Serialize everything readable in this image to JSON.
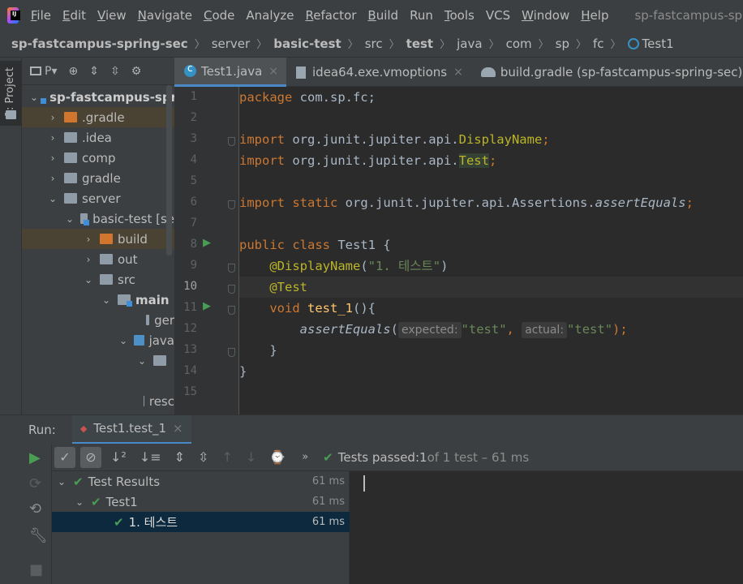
{
  "menu": {
    "items": [
      {
        "label": "File",
        "u": "F",
        "rest": "ile"
      },
      {
        "label": "Edit",
        "u": "E",
        "rest": "dit"
      },
      {
        "label": "View",
        "u": "V",
        "rest": "iew"
      },
      {
        "label": "Navigate",
        "u": "N",
        "rest": "avigate"
      },
      {
        "label": "Code",
        "u": "C",
        "rest": "ode"
      },
      {
        "label": "Analyze",
        "u": "",
        "rest": "Analyze"
      },
      {
        "label": "Refactor",
        "u": "R",
        "rest": "efactor"
      },
      {
        "label": "Build",
        "u": "B",
        "rest": "uild"
      },
      {
        "label": "Run",
        "u": "",
        "rest": "Run"
      },
      {
        "label": "Tools",
        "u": "T",
        "rest": "ools"
      },
      {
        "label": "VCS",
        "u": "",
        "rest": "VCS"
      },
      {
        "label": "Window",
        "u": "W",
        "rest": "indow"
      },
      {
        "label": "Help",
        "u": "H",
        "rest": "elp"
      }
    ],
    "window_title": "sp-fastcampus-spring-sec"
  },
  "breadcrumb": {
    "project": "sp-fastcampus-spring-sec",
    "c1": "server",
    "c2": "basic-test",
    "c3": "src",
    "c4": "test",
    "c5": "java",
    "c6": "com",
    "c7": "sp",
    "c8": "fc",
    "c9": "Test1"
  },
  "stripe": {
    "project_label": "1: Project"
  },
  "project_panel": {
    "toolbar_label": "P▾",
    "tree": [
      {
        "label": "sp-fastcampus-spri",
        "bold": true
      },
      {
        "label": ".gradle"
      },
      {
        "label": ".idea"
      },
      {
        "label": "comp"
      },
      {
        "label": "gradle"
      },
      {
        "label": "server"
      },
      {
        "label": "basic-test [se"
      },
      {
        "label": "build"
      },
      {
        "label": "out"
      },
      {
        "label": "src"
      },
      {
        "label": "main",
        "bold": true
      },
      {
        "label": "ger"
      },
      {
        "label": "java"
      },
      {
        "label": ""
      },
      {
        "label": "resc"
      }
    ]
  },
  "editor": {
    "tabs": [
      {
        "label": "Test1.java"
      },
      {
        "label": "idea64.exe.vmoptions"
      },
      {
        "label": "build.gradle (sp-fastcampus-spring-sec)"
      }
    ],
    "close_glyph": "×",
    "lines": {
      "l1_kw": "package ",
      "l1_rest": "com.sp.fc;",
      "l3_kw": "import ",
      "l3_pkg": "org.junit.jupiter.api.",
      "l3_cls": "DisplayName",
      "l3_end": ";",
      "l4_kw": "import ",
      "l4_pkg": "org.junit.jupiter.api.",
      "l4_cls": "Test",
      "l4_end": ";",
      "l6_kw": "import static ",
      "l6_pkg": "org.junit.jupiter.api.Assertions.",
      "l6_m": "assertEquals",
      "l6_end": ";",
      "l8_kw": "public class ",
      "l8_rest": "Test1 {",
      "l9_ann": "@DisplayName",
      "l9_p1": "(",
      "l9_str": "\"1. 테스트\"",
      "l9_p2": ")",
      "l10_ann": "@Test",
      "l11_kw": "void ",
      "l11_m": "test_1",
      "l11_rest": "(){",
      "l12_m": "assertEquals",
      "l12_p1": "(",
      "l12_h1": "expected:",
      "l12_s1": "\"test\"",
      "l12_c": ", ",
      "l12_h2": "actual:",
      "l12_s2": "\"test\"",
      "l12_end": ");",
      "l13": "}",
      "l14": "}"
    }
  },
  "run": {
    "title": "Run:",
    "tab_label": "Test1.test_1",
    "status_prefix": "Tests passed: ",
    "status_count": "1",
    "status_suffix": " of 1 test – 61 ms",
    "tree": [
      {
        "label": "Test Results",
        "time": "61 ms"
      },
      {
        "label": "Test1",
        "time": "61 ms"
      },
      {
        "label": "1. 테스트",
        "time": "61 ms"
      }
    ]
  }
}
